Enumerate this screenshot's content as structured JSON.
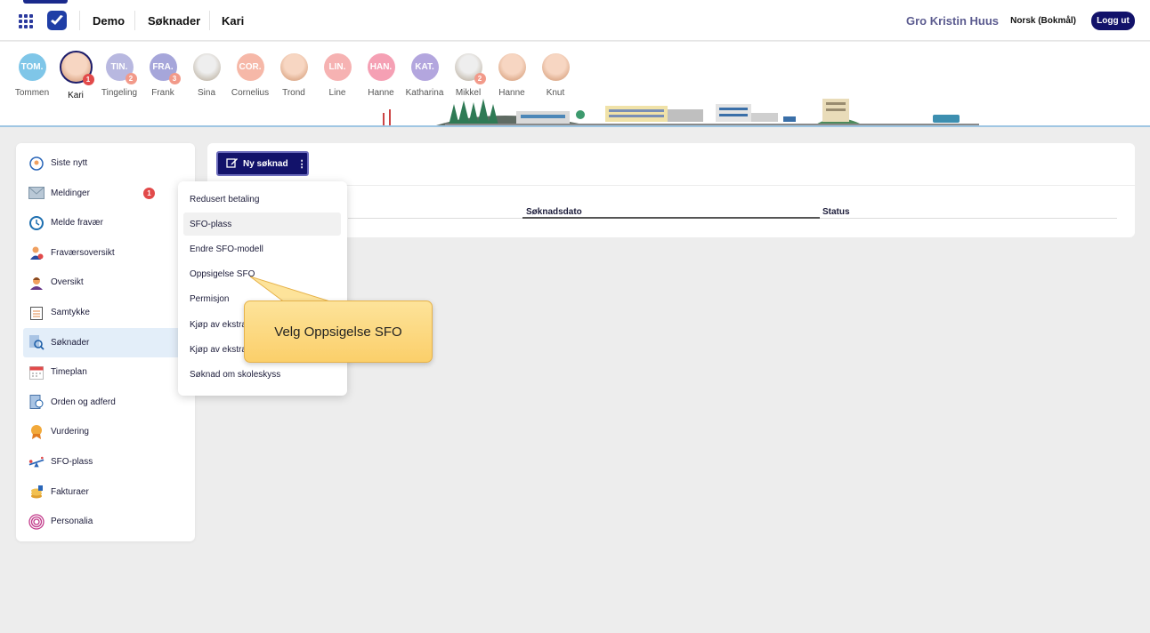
{
  "header": {
    "breadcrumbs": [
      "Demo",
      "Søknader",
      "Kari"
    ],
    "user_name": "Gro Kristin Huus",
    "language": "Norsk (Bokmål)",
    "logout_label": "Logg ut"
  },
  "children": [
    {
      "name": "Tommen",
      "initials": "TOM.",
      "color": "#7fc6e8",
      "photo": false,
      "badge": ""
    },
    {
      "name": "Kari",
      "initials": "",
      "color": "#f2c2a8",
      "photo": true,
      "selected": true,
      "badge": "1",
      "badge_color": "#e24a4a"
    },
    {
      "name": "Tingeling",
      "initials": "TIN.",
      "color": "#b8b8e0",
      "photo": false,
      "badge": "2",
      "badge_color": "#f29a8a"
    },
    {
      "name": "Frank",
      "initials": "FRA.",
      "color": "#a6a6da",
      "photo": false,
      "badge": "3",
      "badge_color": "#f29a8a"
    },
    {
      "name": "Sina",
      "initials": "",
      "color": "#cfc5b8",
      "photo": true,
      "grey": true,
      "badge": ""
    },
    {
      "name": "Cornelius",
      "initials": "COR.",
      "color": "#f6b8a8",
      "photo": false,
      "badge": ""
    },
    {
      "name": "Trond",
      "initials": "",
      "color": "#f2c9b1",
      "photo": true,
      "badge": ""
    },
    {
      "name": "Line",
      "initials": "LIN.",
      "color": "#f6b2b2",
      "photo": false,
      "badge": ""
    },
    {
      "name": "Hanne",
      "initials": "HAN.",
      "color": "#f5a0b4",
      "photo": false,
      "badge": ""
    },
    {
      "name": "Katharina",
      "initials": "KAT.",
      "color": "#b3a6de",
      "photo": false,
      "badge": ""
    },
    {
      "name": "Mikkel",
      "initials": "",
      "color": "#d8cfc6",
      "photo": true,
      "grey": true,
      "badge": "2",
      "badge_color": "#f29a8a"
    },
    {
      "name": "Hanne",
      "initials": "",
      "color": "#f2c9b1",
      "photo": true,
      "badge": ""
    },
    {
      "name": "Knut",
      "initials": "",
      "color": "#f2d0b8",
      "photo": true,
      "badge": ""
    }
  ],
  "sidebar": {
    "items": [
      {
        "label": "Siste nytt",
        "icon": "news-icon"
      },
      {
        "label": "Meldinger",
        "icon": "mail-icon",
        "badge": "1"
      },
      {
        "label": "Melde fravær",
        "icon": "clock-icon"
      },
      {
        "label": "Fraværsoversikt",
        "icon": "absence-person-icon"
      },
      {
        "label": "Oversikt",
        "icon": "person-icon"
      },
      {
        "label": "Samtykke",
        "icon": "checklist-icon"
      },
      {
        "label": "Søknader",
        "icon": "search-document-icon",
        "active": true
      },
      {
        "label": "Timeplan",
        "icon": "calendar-icon"
      },
      {
        "label": "Orden og adferd",
        "icon": "document-icon"
      },
      {
        "label": "Vurdering",
        "icon": "award-icon"
      },
      {
        "label": "SFO-plass",
        "icon": "seesaw-icon"
      },
      {
        "label": "Fakturaer",
        "icon": "coins-icon"
      },
      {
        "label": "Personalia",
        "icon": "fingerprint-icon"
      }
    ]
  },
  "main": {
    "new_button_label": "Ny søknad",
    "columns": [
      "Søknadsdato",
      "Status"
    ]
  },
  "dropdown": {
    "items": [
      "Redusert betaling",
      "SFO-plass",
      "Endre SFO-modell",
      "Oppsigelse SFO",
      "Permisjon",
      "Kjøp av ekstradager",
      "Kjøp av ekstratimer",
      "Søknad om skoleskyss"
    ]
  },
  "tooltip": {
    "text": "Velg Oppsigelse SFO"
  }
}
